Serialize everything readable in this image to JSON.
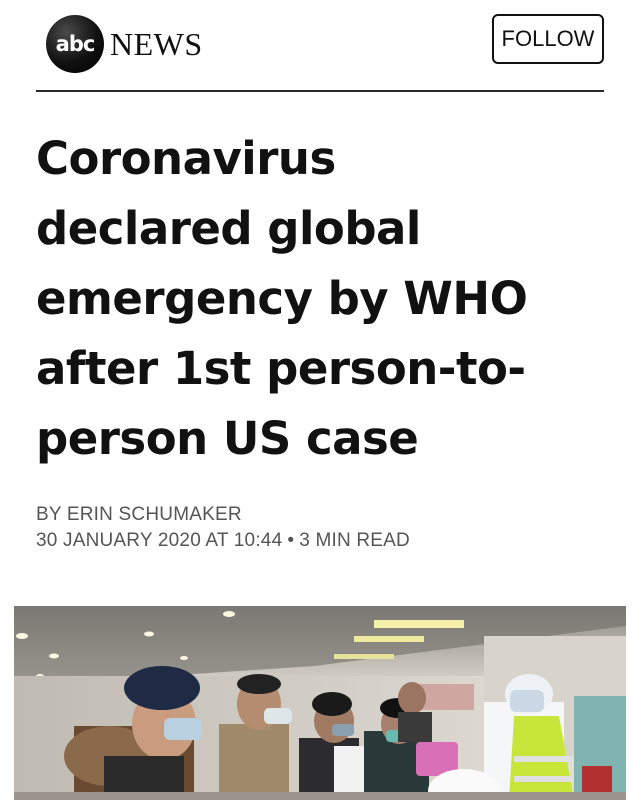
{
  "header": {
    "logo_mark": "abc",
    "logo_text": "NEWS",
    "follow_label": "FOLLOW"
  },
  "article": {
    "headline_lines": [
      "Coronavirus",
      "declared global",
      "emergency by WHO",
      "after 1st person-to-",
      "person US case"
    ],
    "byline": "BY ERIN SCHUMAKER",
    "date": "30 JANUARY 2020 AT 10:44",
    "separator": "•",
    "read_time": "3 MIN READ"
  },
  "image": {
    "subject": "crowded indoor waiting area with masked people and a health worker in protective suit"
  },
  "colors": {
    "text": "#111111",
    "meta": "#555555",
    "rule": "#2a2a2a",
    "hazmat_vest": "#c8e63a"
  }
}
